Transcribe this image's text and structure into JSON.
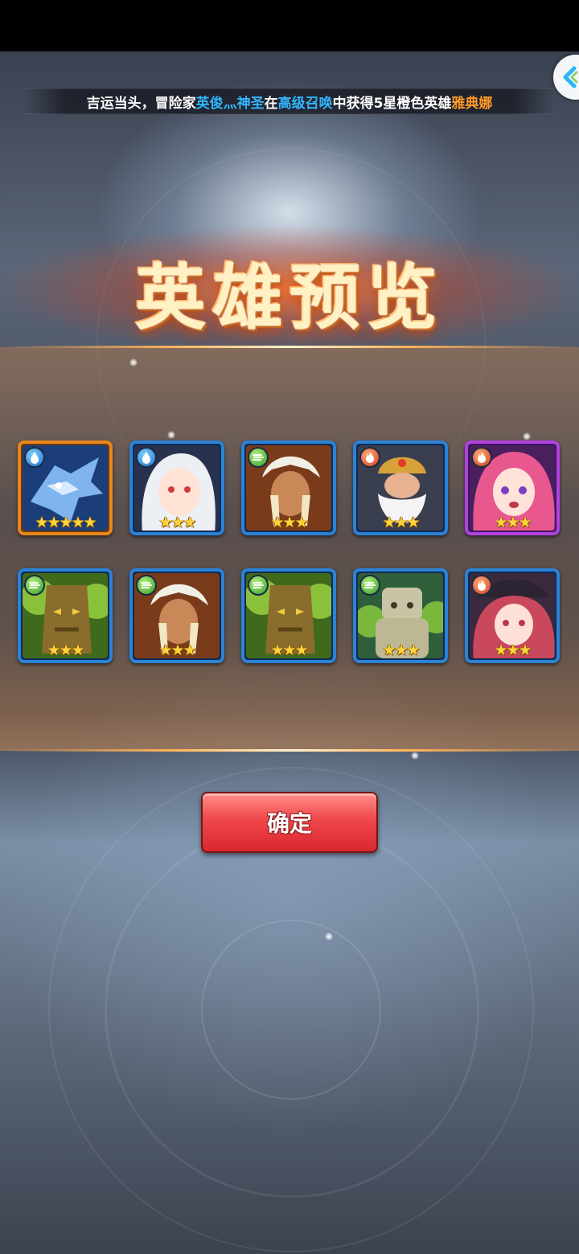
{
  "ticker": {
    "prefix": "吉运当头，冒险家",
    "player_name": "英俊灬神圣",
    "mid1": "在",
    "summon_type": "高级召唤",
    "mid2": "中获得5星橙色英雄",
    "hero_name": "雅典娜"
  },
  "title": "英雄预览",
  "confirm_label": "确定",
  "colors": {
    "highlight_blue": "#33b5ff",
    "highlight_orange": "#ff9a2a",
    "border_blue": "#2b83d6",
    "border_orange": "#e9861c",
    "border_purple": "#b142e0",
    "button_red": "#f0474a"
  },
  "heroes": [
    {
      "element": "water",
      "stars": "★★★★★",
      "rarity": "orange",
      "portrait": "ice-dragon"
    },
    {
      "element": "water",
      "stars": "★★★",
      "rarity": "blue",
      "portrait": "white-haired-girl"
    },
    {
      "element": "wind",
      "stars": "★★★",
      "rarity": "blue",
      "portrait": "eagle-helm-warrior"
    },
    {
      "element": "fire",
      "stars": "★★★",
      "rarity": "blue",
      "portrait": "bearded-dwarf"
    },
    {
      "element": "fire",
      "stars": "★★★",
      "rarity": "purple",
      "portrait": "pink-haired-girl"
    },
    {
      "element": "wind",
      "stars": "★★★",
      "rarity": "blue",
      "portrait": "tree-golem"
    },
    {
      "element": "wind",
      "stars": "★★★",
      "rarity": "blue",
      "portrait": "eagle-helm-warrior"
    },
    {
      "element": "wind",
      "stars": "★★★",
      "rarity": "blue",
      "portrait": "tree-golem"
    },
    {
      "element": "wind",
      "stars": "★★★",
      "rarity": "blue",
      "portrait": "stone-golem"
    },
    {
      "element": "fire",
      "stars": "★★★",
      "rarity": "blue",
      "portrait": "pirate-girl"
    }
  ]
}
